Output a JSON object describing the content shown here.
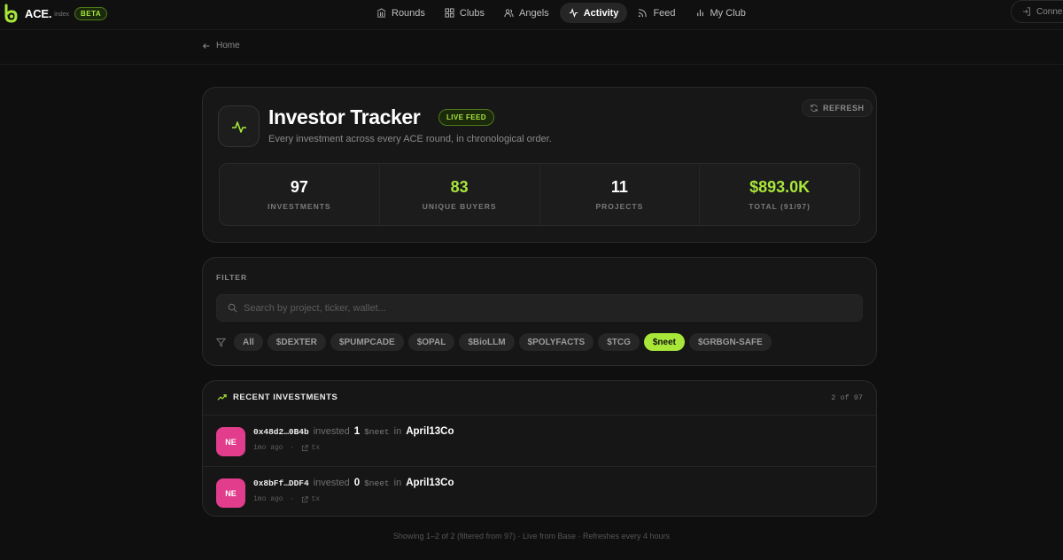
{
  "brand": {
    "name": "ACE.",
    "sub": "index",
    "badge": "BETA"
  },
  "nav": {
    "items": [
      {
        "label": "Rounds",
        "icon": "bank-icon"
      },
      {
        "label": "Clubs",
        "icon": "grid-icon"
      },
      {
        "label": "Angels",
        "icon": "users-icon"
      },
      {
        "label": "Activity",
        "icon": "pulse-icon"
      },
      {
        "label": "Feed",
        "icon": "rss-icon"
      },
      {
        "label": "My Club",
        "icon": "bar-chart-icon"
      }
    ],
    "active": "Activity",
    "connect_label": "Connect"
  },
  "breadcrumb": {
    "label": "Home"
  },
  "hero": {
    "title": "Investor Tracker",
    "badge": "LIVE FEED",
    "description": "Every investment across every ACE round, in chronological order.",
    "refresh_label": "REFRESH",
    "stats": [
      {
        "value": "97",
        "label": "INVESTMENTS",
        "accent": false
      },
      {
        "value": "83",
        "label": "UNIQUE BUYERS",
        "accent": true
      },
      {
        "value": "11",
        "label": "PROJECTS",
        "accent": false
      },
      {
        "value": "$893.0K",
        "label": "TOTAL (91/97)",
        "accent": true
      }
    ]
  },
  "filter": {
    "title": "FILTER",
    "search_placeholder": "Search by project, ticker, wallet...",
    "search_value": "",
    "chips": [
      "All",
      "$DEXTER",
      "$PUMPCADE",
      "$OPAL",
      "$BioLLM",
      "$POLYFACTS",
      "$TCG",
      "$neet",
      "$GRBGN-SAFE"
    ],
    "active_chip": "$neet"
  },
  "recent": {
    "title": "RECENT INVESTMENTS",
    "count": "2 of 97",
    "rows": [
      {
        "avatar": "NE",
        "wallet": "0x48d2…0B4b",
        "verb": "invested",
        "amount": "1",
        "ticker": "$neet",
        "in": "in",
        "project": "April13Co",
        "time": "1mo ago",
        "tx": "tx"
      },
      {
        "avatar": "NE",
        "wallet": "0x8bFf…DDF4",
        "verb": "invested",
        "amount": "0",
        "ticker": "$neet",
        "in": "in",
        "project": "April13Co",
        "time": "1mo ago",
        "tx": "tx"
      }
    ]
  },
  "footer": "Showing 1–2 of 2 (filtered from 97) · Live from Base · Refreshes every 4 hours",
  "colors": {
    "accent": "#a8e63a",
    "avatar": "#e23d8c",
    "background": "#0f0f0f"
  }
}
